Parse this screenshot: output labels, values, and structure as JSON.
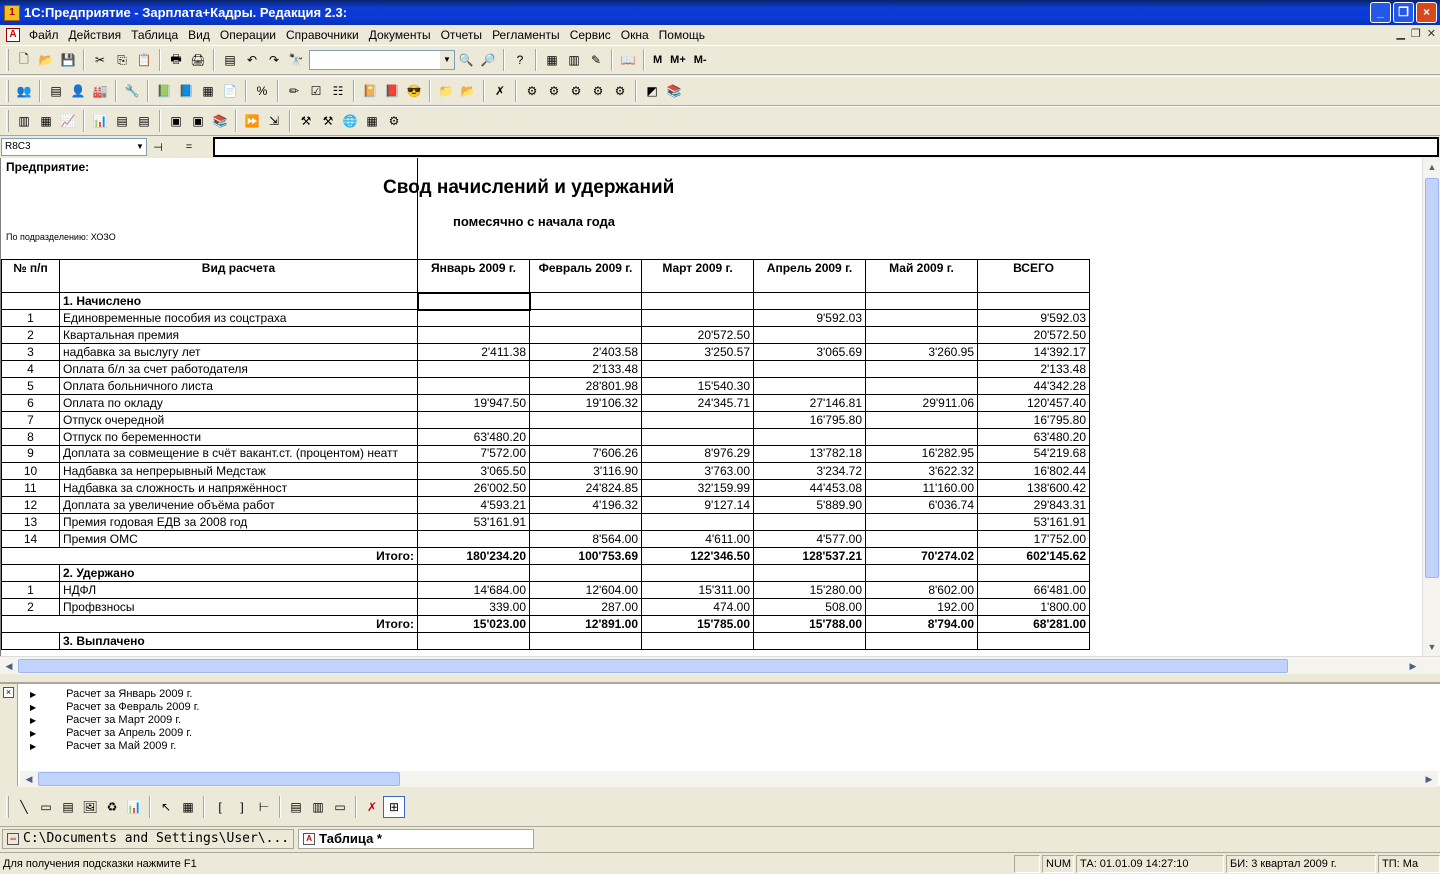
{
  "window": {
    "title": "1С:Предприятие - Зарплата+Кадры. Редакция 2.3:",
    "min": "_",
    "max": "❐",
    "close": "×"
  },
  "menu": [
    "Файл",
    "Действия",
    "Таблица",
    "Вид",
    "Операции",
    "Справочники",
    "Документы",
    "Отчеты",
    "Регламенты",
    "Сервис",
    "Окна",
    "Помощь"
  ],
  "toolbar": {
    "m": "M",
    "mplus": "M+",
    "mminus": "M-"
  },
  "formula": {
    "cellref": "R8C3",
    "eq": "="
  },
  "report": {
    "company_label": "Предприятие:",
    "title": "Свод начислений и удержаний",
    "subtitle": "помесячно с начала года",
    "dept": "По подразделению: ХОЗО",
    "columns": [
      "№ п/п",
      "Вид расчета",
      "Январь 2009 г.",
      "Февраль 2009 г.",
      "Март 2009 г.",
      "Апрель 2009 г.",
      "Май 2009 г.",
      "ВСЕГО"
    ],
    "section1": "1. Начислено",
    "rows1": [
      [
        "1",
        "Единовременные пособия из соцстраха",
        "",
        "",
        "",
        "9'592.03",
        "",
        "9'592.03"
      ],
      [
        "2",
        "Квартальная премия",
        "",
        "",
        "20'572.50",
        "",
        "",
        "20'572.50"
      ],
      [
        "3",
        "надбавка за выслугу лет",
        "2'411.38",
        "2'403.58",
        "3'250.57",
        "3'065.69",
        "3'260.95",
        "14'392.17"
      ],
      [
        "4",
        "Оплата б/л за счет работодателя",
        "",
        "2'133.48",
        "",
        "",
        "",
        "2'133.48"
      ],
      [
        "5",
        "Оплата больничного листа",
        "",
        "28'801.98",
        "15'540.30",
        "",
        "",
        "44'342.28"
      ],
      [
        "6",
        "Оплата по окладу",
        "19'947.50",
        "19'106.32",
        "24'345.71",
        "27'146.81",
        "29'911.06",
        "120'457.40"
      ],
      [
        "7",
        "Отпуск очередной",
        "",
        "",
        "",
        "16'795.80",
        "",
        "16'795.80"
      ],
      [
        "8",
        "Отпуск по беременности",
        "63'480.20",
        "",
        "",
        "",
        "",
        "63'480.20"
      ],
      [
        "9",
        "Доплата за совмещение в счёт вакант.ст. (процентом) неатт",
        "7'572.00",
        "7'606.26",
        "8'976.29",
        "13'782.18",
        "16'282.95",
        "54'219.68"
      ],
      [
        "10",
        "Надбавка за непрерывный Медстаж",
        "3'065.50",
        "3'116.90",
        "3'763.00",
        "3'234.72",
        "3'622.32",
        "16'802.44"
      ],
      [
        "11",
        "Надбавка за сложность и напряжённост",
        "26'002.50",
        "24'824.85",
        "32'159.99",
        "44'453.08",
        "11'160.00",
        "138'600.42"
      ],
      [
        "12",
        "Доплата за увеличение объёма работ",
        "4'593.21",
        "4'196.32",
        "9'127.14",
        "5'889.90",
        "6'036.74",
        "29'843.31"
      ],
      [
        "13",
        "Премия годовая ЕДВ за 2008 год",
        "53'161.91",
        "",
        "",
        "",
        "",
        "53'161.91"
      ],
      [
        "14",
        "Премия ОМС",
        "",
        "8'564.00",
        "4'611.00",
        "4'577.00",
        "",
        "17'752.00"
      ]
    ],
    "total1": [
      "Итого:",
      "180'234.20",
      "100'753.69",
      "122'346.50",
      "128'537.21",
      "70'274.02",
      "602'145.62"
    ],
    "section2": "2. Удержано",
    "rows2": [
      [
        "1",
        "НДФЛ",
        "14'684.00",
        "12'604.00",
        "15'311.00",
        "15'280.00",
        "8'602.00",
        "66'481.00"
      ],
      [
        "2",
        "Профвзносы",
        "339.00",
        "287.00",
        "474.00",
        "508.00",
        "192.00",
        "1'800.00"
      ]
    ],
    "total2": [
      "Итого:",
      "15'023.00",
      "12'891.00",
      "15'785.00",
      "15'788.00",
      "8'794.00",
      "68'281.00"
    ],
    "section3": "3. Выплачено"
  },
  "messages": [
    "Расчет за Январь 2009 г.",
    "Расчет за Февраль 2009 г.",
    "Расчет за Март 2009 г.",
    "Расчет за Апрель 2009 г.",
    "Расчет за Май 2009 г."
  ],
  "taskbar": {
    "item1": "C:\\Documents and Settings\\User\\...",
    "item2": "Таблица  *"
  },
  "status": {
    "hint": "Для получения подсказки нажмите F1",
    "num": "NUM",
    "ta": "ТА: 01.01.09  14:27:10",
    "bi": "БИ: 3 квартал 2009 г.",
    "tp": "ТП: Ма"
  }
}
